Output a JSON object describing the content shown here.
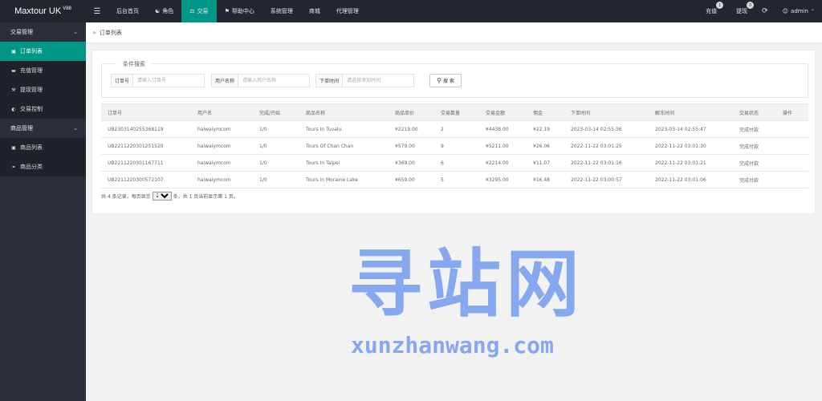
{
  "app": {
    "logo": "Maxtour UK",
    "version": "V88"
  },
  "topnav": {
    "toggle": "☰",
    "items": [
      {
        "label": "后台首页",
        "icon": "",
        "active": false
      },
      {
        "label": "角色",
        "icon": "person-icon",
        "active": false
      },
      {
        "label": "交易",
        "icon": "scale-icon",
        "active": true
      },
      {
        "label": "帮助中心",
        "icon": "flag-icon",
        "active": false
      },
      {
        "label": "系统管理",
        "icon": "",
        "active": false
      },
      {
        "label": "商城",
        "icon": "",
        "active": false
      },
      {
        "label": "代理管理",
        "icon": "",
        "active": false
      }
    ],
    "recharge": {
      "label": "充值",
      "count": "1"
    },
    "withdraw": {
      "label": "提现",
      "count": "0"
    },
    "user": "admin"
  },
  "sidebar": {
    "groups": [
      {
        "label": "交易管理",
        "items": [
          {
            "label": "订单列表",
            "icon": "cart-icon",
            "active": true
          },
          {
            "label": "充值管理",
            "icon": "card-icon",
            "active": false
          },
          {
            "label": "提现管理",
            "icon": "gavel-icon",
            "active": false
          },
          {
            "label": "交易控制",
            "icon": "gauge-icon",
            "active": false
          }
        ]
      },
      {
        "label": "商品管理",
        "items": [
          {
            "label": "商品列表",
            "icon": "cart-icon",
            "active": false
          },
          {
            "label": "商品分类",
            "icon": "link-icon",
            "active": false
          }
        ]
      }
    ]
  },
  "breadcrumb": {
    "label": "订单列表"
  },
  "search": {
    "legend": "条件搜索",
    "order_no": {
      "label": "订单号",
      "placeholder": "请输入订单号"
    },
    "username": {
      "label": "用户名称",
      "placeholder": "请输入用户名称"
    },
    "order_time": {
      "label": "下单时间",
      "placeholder": "请选择添加时间"
    },
    "button": "搜 索"
  },
  "table": {
    "columns": [
      "订单号",
      "用户名",
      "完成/开始",
      "商品名称",
      "商品单价",
      "交易数量",
      "交易金额",
      "佣金",
      "下单时间",
      "解冻时间",
      "交易状态",
      "操作"
    ],
    "rows": [
      [
        "UB2303140255368119",
        "haiwaiymcom",
        "1/0",
        "Tours In Tuvalu",
        "¥2219.00",
        "2",
        "¥4438.00",
        "¥22.19",
        "2023-03-14 02:55:36",
        "2023-03-14 02:55:47",
        "完成付款",
        ""
      ],
      [
        "UB2211220301251520",
        "haiwaiymcom",
        "1/0",
        "Tours Of Chan Chan",
        "¥579.00",
        "9",
        "¥5211.00",
        "¥26.06",
        "2022-11-22 03:01:25",
        "2022-11-22 03:01:30",
        "完成付款",
        ""
      ],
      [
        "UB2211220301167711",
        "haiwaiymcom",
        "1/0",
        "Tours In Taipei",
        "¥369.00",
        "6",
        "¥2214.00",
        "¥11.07",
        "2022-11-22 03:01:16",
        "2022-11-22 03:01:21",
        "完成付款",
        ""
      ],
      [
        "UB2211220300572107",
        "haiwaiymcom",
        "1/0",
        "Tours in Moraine Lake",
        "¥659.00",
        "5",
        "¥3295.00",
        "¥16.48",
        "2022-11-22 03:00:57",
        "2022-11-22 03:01:06",
        "完成付款",
        ""
      ]
    ]
  },
  "pager": {
    "prefix": "共 4 条记录，每页显示",
    "page_size": "20",
    "suffix": "条，共 1 页当前显示第 1 页。"
  },
  "watermark": {
    "cn": "寻站网",
    "en": "xunzhanwang.com"
  },
  "colors": {
    "accent": "#009688",
    "topbar": "#23262e",
    "sidebar": "#2b2f3a"
  }
}
